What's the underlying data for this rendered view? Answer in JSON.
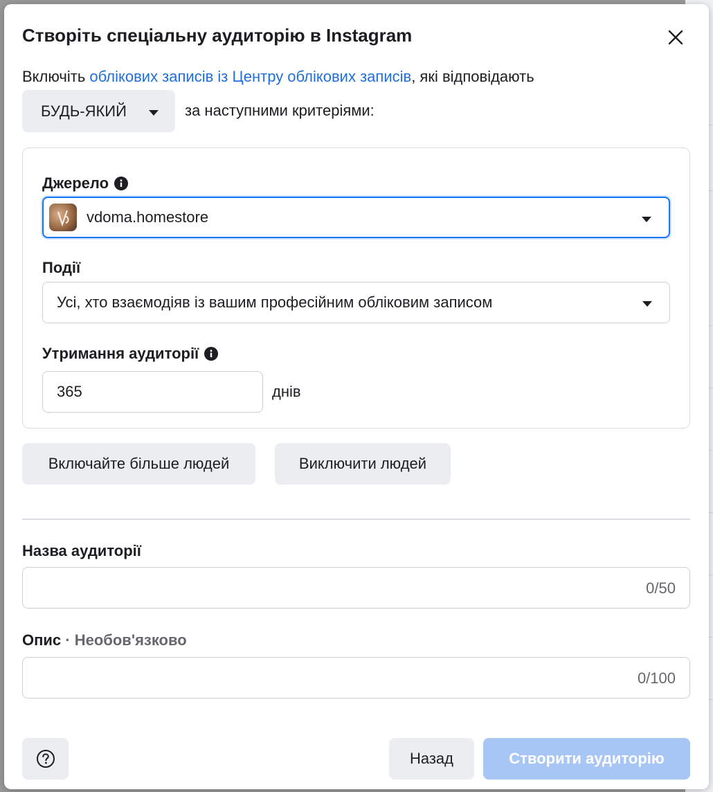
{
  "dialog": {
    "title": "Створіть спеціальну аудиторію в Instagram",
    "close_icon": "close-icon"
  },
  "intro": {
    "prefix": "Включіть ",
    "link": "облікових записів із Центру облікових записів",
    "suffix": ", які відповідають",
    "match_value": "БУДЬ-ЯКИЙ",
    "criteria_text": "за наступними критеріями:"
  },
  "criteria": {
    "source_label": "Джерело",
    "source_value": "vdoma.homestore",
    "events_label": "Події",
    "events_value": "Усі, хто взаємодіяв із вашим професійним обліковим записом",
    "retention_label": "Утримання аудиторії",
    "retention_value": "365",
    "retention_unit": "днів"
  },
  "actions": {
    "include_more": "Включайте більше людей",
    "exclude": "Виключити людей"
  },
  "audience_name": {
    "label": "Назва аудиторії",
    "value": "",
    "counter": "0/50"
  },
  "description": {
    "label": "Опис",
    "optional": " · Необов'язково",
    "value": "",
    "counter": "0/100"
  },
  "footer": {
    "help_icon": "question-circle-icon",
    "back": "Назад",
    "create": "Створити аудиторію"
  },
  "colors": {
    "link": "#216fdb",
    "primary_disabled": "#a7c6f5",
    "focus_border": "#1877f2"
  }
}
